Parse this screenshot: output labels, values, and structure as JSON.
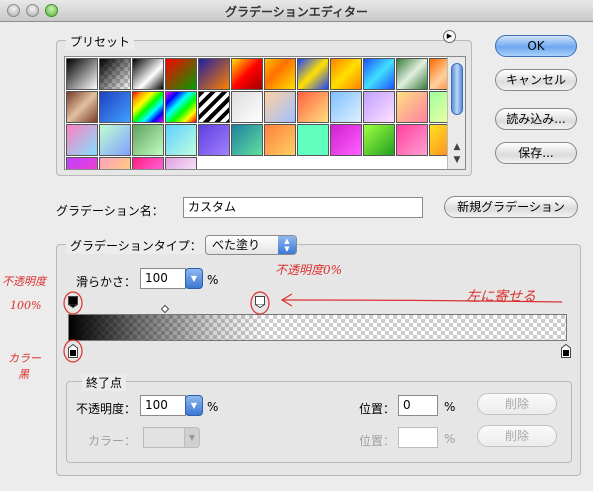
{
  "window": {
    "title": "グラデーションエディター"
  },
  "presets": {
    "label": "プリセット",
    "menu_icon": "triangle-menu-icon",
    "swatches": [
      {
        "bg": "linear-gradient(135deg,#000,#fff)"
      },
      {
        "bg": "linear-gradient(135deg,#000 0%,rgba(0,0,0,0) 100%)",
        "checker": true
      },
      {
        "bg": "linear-gradient(135deg,#000,#fff 60%,#000)"
      },
      {
        "bg": "linear-gradient(135deg,#ff0000,#00a000)"
      },
      {
        "bg": "linear-gradient(135deg,#2020a0,#ff8000)"
      },
      {
        "bg": "linear-gradient(135deg,#ffe000,#ff0000 50%,#a00000)"
      },
      {
        "bg": "linear-gradient(135deg,#ffc000,#ff7000 40%,#ffe000)"
      },
      {
        "bg": "linear-gradient(135deg,#2040ff,#ffe000 50%,#2040ff)"
      },
      {
        "bg": "linear-gradient(135deg,#ff8000,#ffe000 50%,#ff8000)"
      },
      {
        "bg": "linear-gradient(135deg,#2050ff,#40e0ff 50%,#2050ff)"
      },
      {
        "bg": "linear-gradient(135deg,#3a7a3a,#e0f0e0 50%,#3a7a3a)"
      },
      {
        "bg": "linear-gradient(135deg,#ff6a00,#ffd0a0 50%,#ff6a00)"
      },
      {
        "bg": "linear-gradient(135deg,#7a3a2a,#e0c0a0 50%,#7a3a2a)"
      },
      {
        "bg": "linear-gradient(135deg,#2040c0,#40a0ff)"
      },
      {
        "bg": "linear-gradient(135deg,red,orange,yellow,lime,cyan,blue,magenta)"
      },
      {
        "bg": "linear-gradient(135deg,magenta,blue,cyan,lime,yellow,red)"
      },
      {
        "bg": "repeating-linear-gradient(135deg,#000 0 4px,#fff 4px 8px)"
      },
      {
        "bg": "linear-gradient(135deg,#ddd,#fff)",
        "checker": true
      },
      {
        "bg": "linear-gradient(135deg,#ffd0a0,#a0c0ff)"
      },
      {
        "bg": "linear-gradient(135deg,#ff6040,#ffe080)"
      },
      {
        "bg": "linear-gradient(135deg,#80c0ff,#e0f0ff)"
      },
      {
        "bg": "linear-gradient(135deg,#c0a0ff,#ffe0ff)"
      },
      {
        "bg": "linear-gradient(135deg,#ffe080,#ff80a0)"
      },
      {
        "bg": "linear-gradient(135deg,#a0ffa0,#ffffa0)"
      },
      {
        "bg": "linear-gradient(135deg,#ff80c0,#80e0ff)"
      },
      {
        "bg": "linear-gradient(135deg,#c0ffd0,#80a0ff)"
      },
      {
        "bg": "linear-gradient(135deg,#60a060,#c0ffc0)"
      },
      {
        "bg": "linear-gradient(135deg,#60d0ff,#c0ffe0)"
      },
      {
        "bg": "linear-gradient(135deg,#6040e0,#a080ff)"
      },
      {
        "bg": "linear-gradient(135deg,#2080a0,#60e0a0)"
      },
      {
        "bg": "linear-gradient(135deg,#ff8040,#ffd060)"
      },
      {
        "bg": "linear-gradient(135deg,#60ffc0,#60ffc0)"
      },
      {
        "bg": "linear-gradient(135deg,#d020d0,#ff60ff)"
      },
      {
        "bg": "linear-gradient(135deg,#a0ff40,#20a020)"
      },
      {
        "bg": "linear-gradient(135deg,#ff40a0,#ffa0d0)"
      },
      {
        "bg": "linear-gradient(135deg,#ffe020,#ff8020)"
      },
      {
        "bg": "linear-gradient(135deg,#c040ff,#ff40c0)"
      },
      {
        "bg": "linear-gradient(135deg,#ffa0c0,#ffe060)"
      },
      {
        "bg": "linear-gradient(135deg,#ff2080,#ff80ff)"
      },
      {
        "bg": "linear-gradient(135deg,#e0a0e0,#fff)",
        "checker": true
      }
    ]
  },
  "buttons": {
    "ok": "OK",
    "cancel": "キャンセル",
    "load": "読み込み...",
    "save": "保存...",
    "new_gradient": "新規グラデーション"
  },
  "name_field": {
    "label": "グラデーション名：",
    "value": "カスタム"
  },
  "gradient_type": {
    "label": "グラデーションタイプ：",
    "selected": "べた塗り",
    "smoothness_label": "滑らかさ：",
    "smoothness_value": "100",
    "percent": "%"
  },
  "stops": {
    "label": "終了点",
    "opacity_label": "不透明度：",
    "opacity_value": "100",
    "opacity_percent": "%",
    "opacity_location_label": "位置：",
    "opacity_location_value": "0",
    "opacity_location_percent": "%",
    "opacity_delete": "削除",
    "color_label": "カラー：",
    "color_location_label": "位置：",
    "color_location_value": "",
    "color_location_percent": "%",
    "color_delete": "削除"
  },
  "annotations": {
    "opacity_stop_left_line1": "不透明度",
    "opacity_stop_left_line2": "100%",
    "color_stop_line1": "カラー",
    "color_stop_line2": "黒",
    "opacity_zero": "不透明度0%",
    "move_left": "左に寄せる",
    "color": "#d9312f"
  }
}
